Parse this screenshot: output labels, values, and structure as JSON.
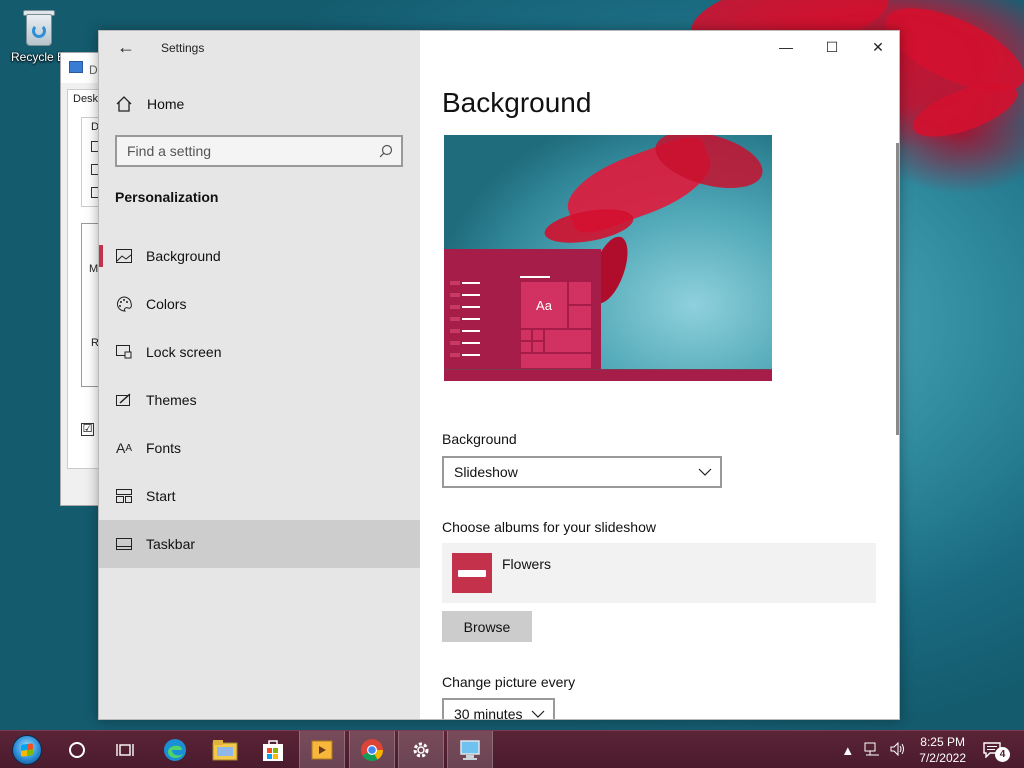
{
  "desktop": {
    "recycle_bin_label": "Recycle B"
  },
  "background_window": {
    "title": "D",
    "tab_label": "Desk",
    "group_label": "D",
    "group2_label_a": "M",
    "group2_label_b": "R",
    "checkbox_mark": "☑"
  },
  "settings": {
    "app_title": "Settings",
    "back_icon": "←",
    "home_label": "Home",
    "search_placeholder": "Find a setting",
    "section_title": "Personalization",
    "nav_items": [
      {
        "label": "Background",
        "icon": "image-icon"
      },
      {
        "label": "Colors",
        "icon": "palette-icon"
      },
      {
        "label": "Lock screen",
        "icon": "lock-screen-icon"
      },
      {
        "label": "Themes",
        "icon": "themes-icon"
      },
      {
        "label": "Fonts",
        "icon": "fonts-icon",
        "glyph": "A"
      },
      {
        "label": "Start",
        "icon": "start-icon"
      },
      {
        "label": "Taskbar",
        "icon": "taskbar-icon"
      }
    ],
    "window_controls": {
      "minimize": "—",
      "maximize": "☐",
      "close": "✕"
    },
    "page_title": "Background",
    "preview_sample_text": "Aa",
    "background_label": "Background",
    "background_value": "Slideshow",
    "albums_label": "Choose albums for your slideshow",
    "album_name": "Flowers",
    "browse_label": "Browse",
    "change_picture_label": "Change picture every",
    "change_picture_value": "30 minutes",
    "accent_color": "#c4314b"
  },
  "taskbar": {
    "clock_time": "8:25 PM",
    "clock_date": "7/2/2022",
    "notification_count": "4",
    "tray_icons": [
      "chevron-up-icon",
      "network-icon",
      "volume-icon"
    ],
    "pinned": [
      "start-orb",
      "cortana-icon",
      "task-view-icon",
      "edge-icon",
      "file-explorer-icon",
      "store-icon",
      "media-player-icon",
      "chrome-icon",
      "settings-icon",
      "display-properties-icon"
    ]
  }
}
